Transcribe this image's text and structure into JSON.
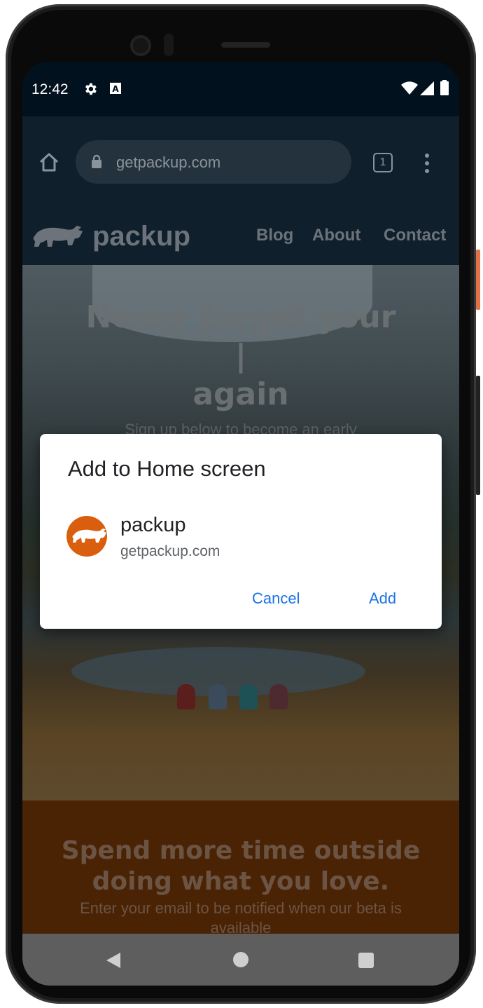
{
  "status_bar": {
    "time": "12:42"
  },
  "browser": {
    "url": "getpackup.com",
    "tab_count": "1"
  },
  "site": {
    "brand": "packup",
    "nav": [
      "Blog",
      "About",
      "Contact"
    ],
    "hero_line1": "Never forget your",
    "hero_line2": "|",
    "hero_line3": "again",
    "hero_sub": "Sign up below to become an early",
    "promo_title_1": "Spend more time outside",
    "promo_title_2": "doing what you love.",
    "promo_sub_1": "Enter your email to be notified when our beta is",
    "promo_sub_2": "available"
  },
  "dialog": {
    "title": "Add to Home screen",
    "app_name": "packup",
    "app_url": "getpackup.com",
    "cancel_label": "Cancel",
    "add_label": "Add"
  },
  "colors": {
    "accent": "#1a73e8",
    "brand_orange": "#d95f0e",
    "status_bar": "#01111d"
  },
  "icons": [
    "settings-icon",
    "font-icon",
    "wifi-icon",
    "signal-icon",
    "battery-icon",
    "home-icon",
    "lock-icon",
    "tabs-icon",
    "menu-icon",
    "yak-logo-icon",
    "back-icon",
    "home-nav-icon",
    "recents-icon"
  ]
}
